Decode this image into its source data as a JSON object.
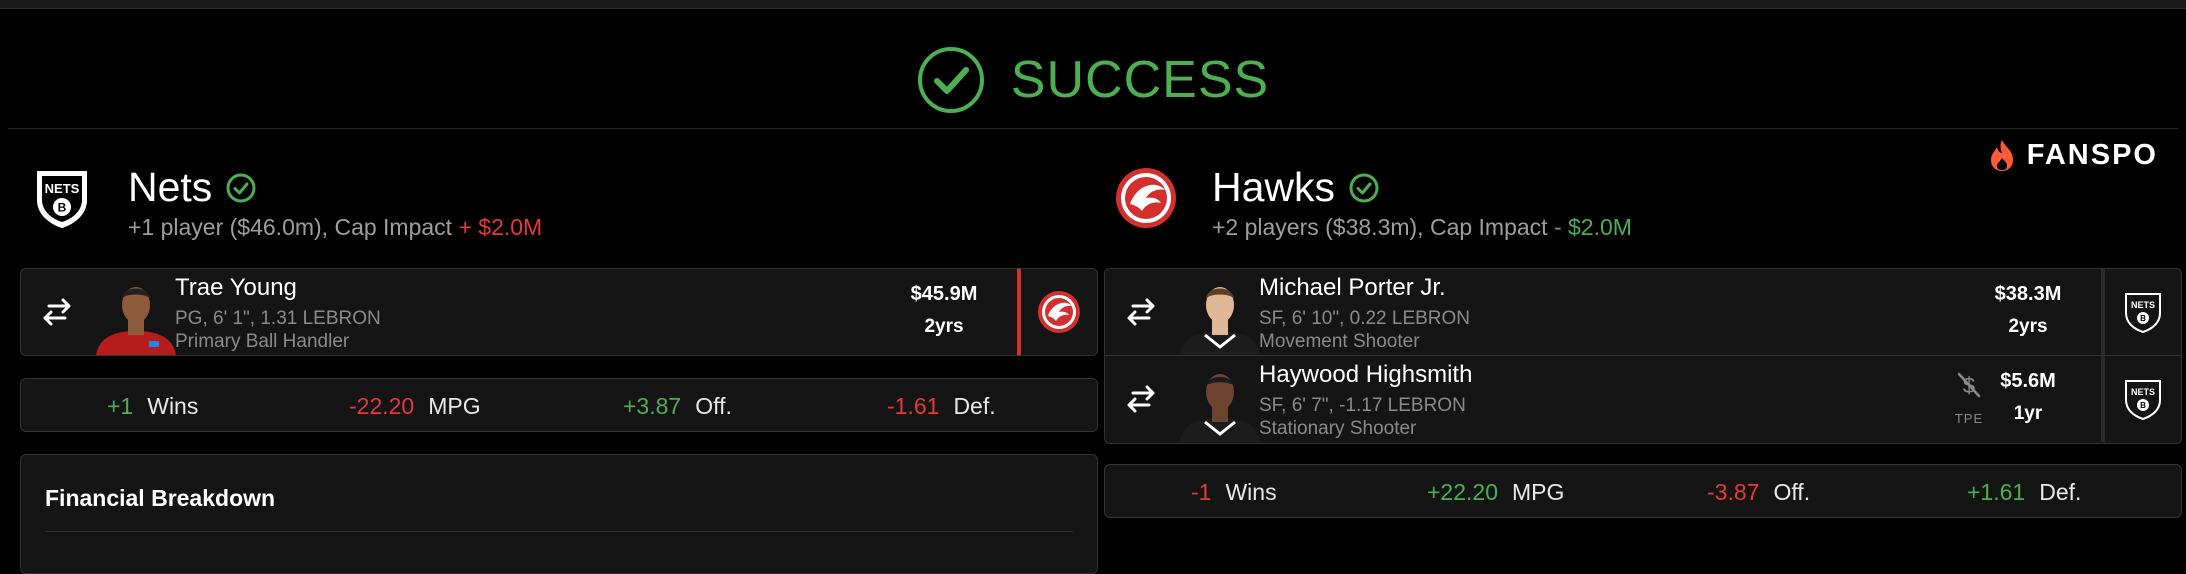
{
  "banner": {
    "status": "SUCCESS",
    "icon": "check-circle-icon",
    "color": "#4caf50"
  },
  "brand": {
    "name": "FANSPO",
    "icon": "flame-icon",
    "color": "#ff5a36"
  },
  "teams": [
    {
      "name": "Nets",
      "logo": "nets-logo",
      "subtitle": "+1 player ($46.0m), Cap Impact",
      "cap_impact": "+ $2.0M",
      "players": [
        {
          "name": "Trae Young",
          "meta": "PG, 6' 1\", 1.31 LEBRON",
          "role": "Primary Ball Handler",
          "salary": "$45.9M",
          "years": "2yrs",
          "destination": "hawks-logo"
        }
      ],
      "stats": [
        {
          "value": "+1",
          "label": "Wins"
        },
        {
          "value": "-22.20",
          "label": "MPG"
        },
        {
          "value": "+3.87",
          "label": "Off."
        },
        {
          "value": "-1.61",
          "label": "Def."
        }
      ],
      "financial": {
        "title": "Financial Breakdown"
      }
    },
    {
      "name": "Hawks",
      "logo": "hawks-logo",
      "subtitle": "+2 players ($38.3m), Cap Impact",
      "cap_impact": "- $2.0M",
      "players": [
        {
          "name": "Michael Porter Jr.",
          "meta": "SF, 6' 10\", 0.22 LEBRON",
          "role": "Movement Shooter",
          "salary": "$38.3M",
          "years": "2yrs",
          "destination": "nets-logo"
        },
        {
          "name": "Haywood Highsmith",
          "meta": "SF, 6' 7\", -1.17 LEBRON",
          "role": "Stationary Shooter",
          "salary": "$5.6M",
          "years": "1yr",
          "tpe": "TPE",
          "destination": "nets-logo"
        }
      ],
      "stats": [
        {
          "value": "-1",
          "label": "Wins"
        },
        {
          "value": "+22.20",
          "label": "MPG"
        },
        {
          "value": "-3.87",
          "label": "Off."
        },
        {
          "value": "+1.61",
          "label": "Def."
        }
      ]
    }
  ],
  "colors": {
    "positive": "#4caf50",
    "negative": "#e53935",
    "hawks_red": "#d32f2f"
  }
}
